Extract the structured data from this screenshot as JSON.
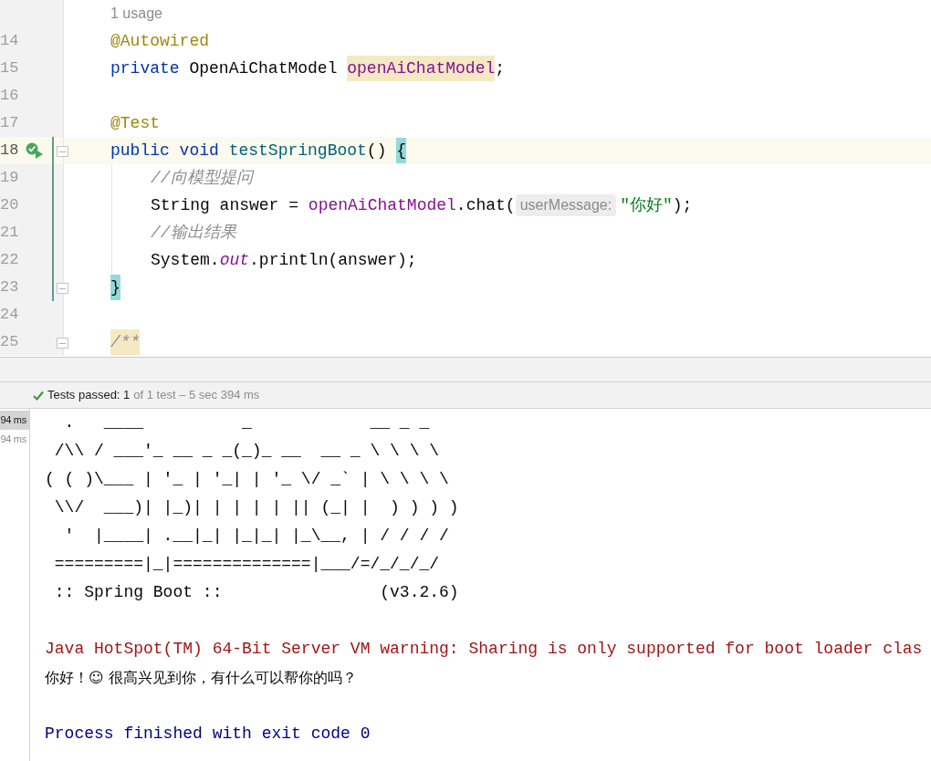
{
  "editor": {
    "usage_hint": "1 usage",
    "lines": [
      {
        "number": "14",
        "current": false,
        "run_icon": false,
        "fold": false,
        "tokens": [
          {
            "kind": "annotation",
            "text": "@Autowired"
          }
        ]
      },
      {
        "number": "15",
        "current": false,
        "run_icon": false,
        "fold": false,
        "tokens": [
          {
            "kind": "keyword",
            "text": "private "
          },
          {
            "kind": "plain",
            "text": "OpenAiChatModel "
          },
          {
            "kind": "field",
            "text": "openAiChatModel",
            "highlighted": true
          },
          {
            "kind": "plain",
            "text": ";"
          }
        ]
      },
      {
        "number": "16",
        "current": false,
        "run_icon": false,
        "fold": false
      },
      {
        "number": "17",
        "current": false,
        "run_icon": false,
        "fold": false,
        "tokens": [
          {
            "kind": "annotation",
            "text": "@Test"
          }
        ]
      },
      {
        "number": "18",
        "current": true,
        "run_icon": true,
        "fold": true,
        "tokens": [
          {
            "kind": "keyword",
            "text": "public void "
          },
          {
            "kind": "method",
            "text": "testSpringBoot"
          },
          {
            "kind": "plain",
            "text": "() "
          },
          {
            "kind": "plain",
            "text": "{",
            "highlighted": true
          }
        ]
      },
      {
        "number": "19",
        "current": false,
        "run_icon": false,
        "fold": false,
        "indent": true,
        "tokens": [
          {
            "kind": "comment",
            "text": "//向模型提问"
          }
        ]
      },
      {
        "number": "20",
        "current": false,
        "run_icon": false,
        "fold": false,
        "indent": true,
        "tokens": [
          {
            "kind": "plain",
            "text": "String answer = "
          },
          {
            "kind": "field",
            "text": "openAiChatModel"
          },
          {
            "kind": "plain",
            "text": ".chat("
          },
          {
            "kind": "hint",
            "text": "userMessage:"
          },
          {
            "kind": "string",
            "text": "\"你好\""
          },
          {
            "kind": "plain",
            "text": ");"
          }
        ]
      },
      {
        "number": "21",
        "current": false,
        "run_icon": false,
        "fold": false,
        "indent": true,
        "tokens": [
          {
            "kind": "comment",
            "text": "//输出结果"
          }
        ]
      },
      {
        "number": "22",
        "current": false,
        "run_icon": false,
        "fold": false,
        "indent": true,
        "tokens": [
          {
            "kind": "plain",
            "text": "System."
          },
          {
            "kind": "static",
            "text": "out"
          },
          {
            "kind": "plain",
            "text": ".println(answer);"
          }
        ]
      },
      {
        "number": "23",
        "current": false,
        "run_icon": false,
        "fold": true,
        "tokens": [
          {
            "kind": "plain",
            "text": "}",
            "highlighted": true
          }
        ]
      },
      {
        "number": "24",
        "current": false,
        "run_icon": false,
        "fold": false
      },
      {
        "number": "25",
        "current": false,
        "run_icon": false,
        "fold": true,
        "tokens": [
          {
            "kind": "doc",
            "text": "/**",
            "highlighted": true
          }
        ]
      }
    ]
  },
  "test_status": {
    "passed": "Tests passed: 1",
    "rest": "of 1 test – 5 sec 394 ms"
  },
  "test_tree": [
    {
      "text": "94 ms",
      "selected": true
    },
    {
      "text": "94 ms",
      "selected": false
    }
  ],
  "console": [
    {
      "kind": "banner",
      "text": "  .   ____          _            __ _ _"
    },
    {
      "kind": "banner",
      "text": " /\\\\ / ___'_ __ _ _(_)_ __  __ _ \\ \\ \\ \\"
    },
    {
      "kind": "banner",
      "text": "( ( )\\___ | '_ | '_| | '_ \\/ _` | \\ \\ \\ \\"
    },
    {
      "kind": "banner",
      "text": " \\\\/  ___)| |_)| | | | | || (_| |  ) ) ) )"
    },
    {
      "kind": "banner",
      "text": "  '  |____| .__|_| |_|_| |_\\__, | / / / /"
    },
    {
      "kind": "banner",
      "text": " =========|_|==============|___/=/_/_/_/"
    },
    {
      "kind": "banner",
      "text": " :: Spring Boot ::                (v3.2.6)"
    },
    {
      "kind": "blank"
    },
    {
      "kind": "warning",
      "text": "Java HotSpot(TM) 64-Bit Server VM warning: Sharing is only supported for boot loader clas"
    },
    {
      "kind": "output",
      "text": "你好！☺ 很高兴见到你，有什么可以帮你的吗？"
    },
    {
      "kind": "blank"
    },
    {
      "kind": "process",
      "text": "Process finished with exit code 0"
    }
  ]
}
